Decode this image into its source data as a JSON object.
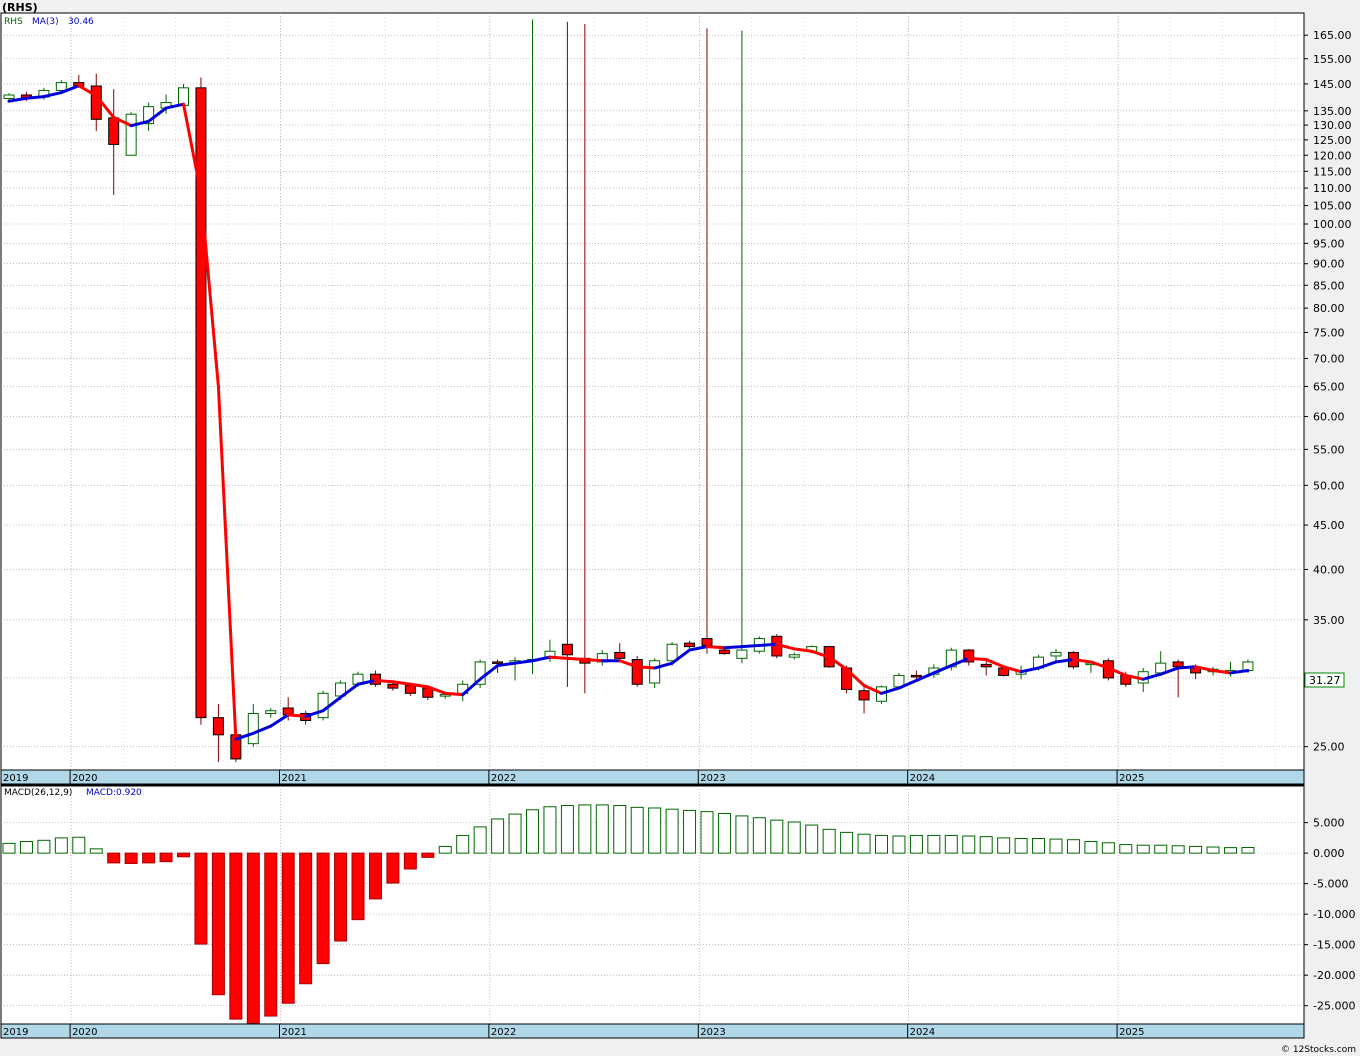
{
  "header": {
    "title": "(RHS)",
    "ticker_label": "RHS",
    "ma_label": "MA(3)",
    "ma_value": "30.46",
    "macd_label": "MACD(26,12,9)",
    "macd_value": "MACD:0.920",
    "last_price": "31.27",
    "credit": "© 12Stocks.com"
  },
  "colors": {
    "up": "#006600",
    "down": "#ff0000",
    "ma_up": "#0000dd",
    "ma_down": "#ff0000",
    "axis_band": "#b0d8e8",
    "grid": "#999999",
    "price_box_border": "#008800"
  },
  "chart_data": [
    {
      "type": "candlestick",
      "scale": "log",
      "ylim": [
        23.5,
        175
      ],
      "yticks": [
        25,
        30,
        35,
        40,
        45,
        50,
        55,
        60,
        65,
        70,
        75,
        80,
        85,
        90,
        95,
        100,
        105,
        110,
        115,
        120,
        125,
        130,
        135,
        145,
        155,
        165
      ],
      "ytick_labels": [
        "25.00",
        "30.00",
        "35.00",
        "40.00",
        "45.00",
        "50.00",
        "55.00",
        "60.00",
        "65.00",
        "70.00",
        "75.00",
        "80.00",
        "85.00",
        "90.00",
        "95.00",
        "100.00",
        "105.00",
        "110.00",
        "115.00",
        "120.00",
        "125.00",
        "130.00",
        "135.00",
        "145.00",
        "155.00",
        "165.00"
      ],
      "x_year_labels": [
        {
          "label": "2019",
          "idx": -0.3
        },
        {
          "label": "2020",
          "idx": 4
        },
        {
          "label": "2021",
          "idx": 16
        },
        {
          "label": "2022",
          "idx": 28
        },
        {
          "label": "2023",
          "idx": 40
        },
        {
          "label": "2024",
          "idx": 52
        },
        {
          "label": "2025",
          "idx": 64
        }
      ],
      "candles": [
        [
          139.5,
          141.5,
          138.0,
          140.8
        ],
        [
          140.8,
          142.0,
          138.5,
          139.8
        ],
        [
          140.0,
          143.5,
          139.0,
          142.5
        ],
        [
          142.5,
          146.5,
          141.8,
          145.5
        ],
        [
          145.5,
          148.5,
          143.5,
          144.2
        ],
        [
          144.2,
          149.0,
          128.0,
          132.0
        ],
        [
          132.5,
          143.0,
          108.0,
          123.5
        ],
        [
          120.0,
          134.5,
          120.0,
          133.8
        ],
        [
          130.5,
          138.0,
          128.0,
          136.5
        ],
        [
          136.0,
          141.0,
          134.0,
          138.0
        ],
        [
          137.0,
          145.0,
          135.5,
          143.5
        ],
        [
          143.5,
          147.5,
          26.5,
          27.0
        ],
        [
          27.0,
          28.0,
          24.0,
          25.8
        ],
        [
          25.8,
          26.5,
          24.0,
          24.2
        ],
        [
          25.2,
          28.0,
          25.0,
          27.3
        ],
        [
          27.3,
          27.7,
          27.0,
          27.5
        ],
        [
          27.7,
          28.5,
          26.8,
          27.2
        ],
        [
          27.3,
          27.5,
          26.5,
          26.8
        ],
        [
          27.0,
          29.0,
          26.8,
          28.8
        ],
        [
          28.6,
          29.8,
          28.3,
          29.6
        ],
        [
          29.5,
          30.5,
          29.3,
          30.3
        ],
        [
          30.3,
          30.6,
          29.3,
          29.5
        ],
        [
          29.5,
          29.8,
          29.0,
          29.2
        ],
        [
          29.4,
          29.6,
          28.6,
          28.8
        ],
        [
          29.2,
          29.4,
          28.3,
          28.5
        ],
        [
          28.6,
          28.9,
          28.4,
          28.7
        ],
        [
          28.8,
          29.8,
          28.2,
          29.5
        ],
        [
          29.5,
          31.5,
          29.2,
          31.3
        ],
        [
          31.3,
          31.5,
          30.4,
          31.2
        ],
        [
          31.2,
          31.7,
          29.8,
          31.4
        ],
        [
          31.4,
          172.0,
          30.3,
          31.5
        ],
        [
          31.6,
          33.2,
          31.3,
          32.2
        ],
        [
          32.8,
          171.0,
          29.3,
          31.9
        ],
        [
          31.6,
          170.0,
          28.8,
          31.2
        ],
        [
          31.3,
          32.3,
          31.0,
          32.0
        ],
        [
          32.1,
          32.9,
          31.3,
          31.6
        ],
        [
          31.5,
          31.8,
          29.3,
          29.5
        ],
        [
          29.6,
          31.6,
          29.2,
          31.4
        ],
        [
          31.4,
          33.0,
          31.0,
          32.8
        ],
        [
          32.9,
          33.1,
          32.3,
          32.6
        ],
        [
          33.3,
          168.0,
          32.0,
          32.7
        ],
        [
          32.3,
          32.5,
          31.9,
          32.0
        ],
        [
          31.6,
          167.0,
          31.2,
          32.3
        ],
        [
          32.2,
          33.5,
          32.0,
          33.3
        ],
        [
          33.5,
          33.7,
          31.6,
          31.8
        ],
        [
          31.7,
          32.1,
          31.5,
          31.9
        ],
        [
          32.2,
          32.7,
          32.0,
          32.6
        ],
        [
          32.6,
          32.6,
          30.8,
          30.9
        ],
        [
          30.8,
          31.0,
          28.8,
          29.1
        ],
        [
          29.0,
          29.3,
          27.3,
          28.3
        ],
        [
          28.2,
          29.4,
          28.0,
          29.3
        ],
        [
          29.3,
          30.4,
          29.1,
          30.2
        ],
        [
          30.2,
          30.6,
          29.9,
          30.1
        ],
        [
          30.3,
          31.1,
          30.0,
          30.8
        ],
        [
          30.9,
          32.5,
          30.6,
          32.3
        ],
        [
          32.3,
          32.4,
          31.0,
          31.3
        ],
        [
          31.1,
          31.4,
          30.2,
          30.9
        ],
        [
          30.8,
          31.0,
          30.1,
          30.2
        ],
        [
          30.3,
          31.0,
          29.9,
          30.6
        ],
        [
          30.8,
          31.9,
          30.6,
          31.7
        ],
        [
          31.8,
          32.4,
          31.4,
          32.1
        ],
        [
          32.1,
          32.2,
          30.7,
          30.9
        ],
        [
          31.1,
          31.4,
          30.4,
          31.2
        ],
        [
          31.4,
          31.6,
          29.8,
          30.0
        ],
        [
          30.2,
          30.5,
          29.3,
          29.5
        ],
        [
          29.6,
          30.8,
          28.9,
          30.5
        ],
        [
          30.4,
          32.2,
          30.2,
          31.2
        ],
        [
          31.3,
          31.5,
          28.5,
          30.9
        ],
        [
          30.9,
          31.1,
          29.9,
          30.4
        ],
        [
          30.5,
          30.9,
          30.2,
          30.7
        ],
        [
          30.4,
          31.3,
          30.1,
          30.6
        ],
        [
          30.6,
          31.5,
          30.4,
          31.3
        ]
      ],
      "ma": [
        138.5,
        139.6,
        140.2,
        141.7,
        144.3,
        140.5,
        132.7,
        129.8,
        131.3,
        136.0,
        137.4,
        108.5,
        65.0,
        25.5,
        25.9,
        26.4,
        27.2,
        27.1,
        27.5,
        28.5,
        29.5,
        29.8,
        29.7,
        29.5,
        29.3,
        28.8,
        28.7,
        29.9,
        31.0,
        31.2,
        31.4,
        31.7,
        31.6,
        31.5,
        31.4,
        31.4,
        30.9,
        30.8,
        31.2,
        32.3,
        32.6,
        32.5,
        32.6,
        32.7,
        32.8,
        32.4,
        32.2,
        31.7,
        30.7,
        29.4,
        28.8,
        29.2,
        29.8,
        30.4,
        31.0,
        31.6,
        31.5,
        30.9,
        30.5,
        30.8,
        31.3,
        31.5,
        31.3,
        30.8,
        30.2,
        29.9,
        30.3,
        30.8,
        30.9,
        30.6,
        30.4,
        30.6
      ]
    },
    {
      "type": "bar",
      "name": "MACD(26,12,9)",
      "ylim": [
        -28.0,
        11.0
      ],
      "yticks": [
        5,
        0,
        -5,
        -10,
        -15,
        -20,
        -25
      ],
      "ytick_labels": [
        "5.000",
        "0.000",
        "-5.000",
        "-10.000",
        "-15.000",
        "-20.000",
        "-25.000"
      ],
      "values": [
        1.6,
        1.9,
        2.1,
        2.5,
        2.6,
        0.7,
        -1.6,
        -1.7,
        -1.6,
        -1.4,
        -0.6,
        -14.9,
        -23.2,
        -27.2,
        -27.9,
        -26.7,
        -24.6,
        -21.4,
        -18.1,
        -14.4,
        -10.9,
        -7.5,
        -4.9,
        -2.6,
        -0.7,
        1.1,
        2.9,
        4.3,
        5.6,
        6.4,
        7.1,
        7.6,
        7.8,
        7.9,
        7.9,
        7.8,
        7.5,
        7.4,
        7.2,
        7.0,
        6.8,
        6.5,
        6.1,
        5.8,
        5.4,
        5.1,
        4.6,
        3.9,
        3.4,
        3.1,
        2.9,
        2.8,
        2.9,
        2.9,
        2.9,
        2.8,
        2.7,
        2.5,
        2.4,
        2.4,
        2.3,
        2.2,
        1.9,
        1.7,
        1.4,
        1.3,
        1.3,
        1.2,
        1.1,
        1.0,
        0.9,
        0.92
      ]
    }
  ]
}
